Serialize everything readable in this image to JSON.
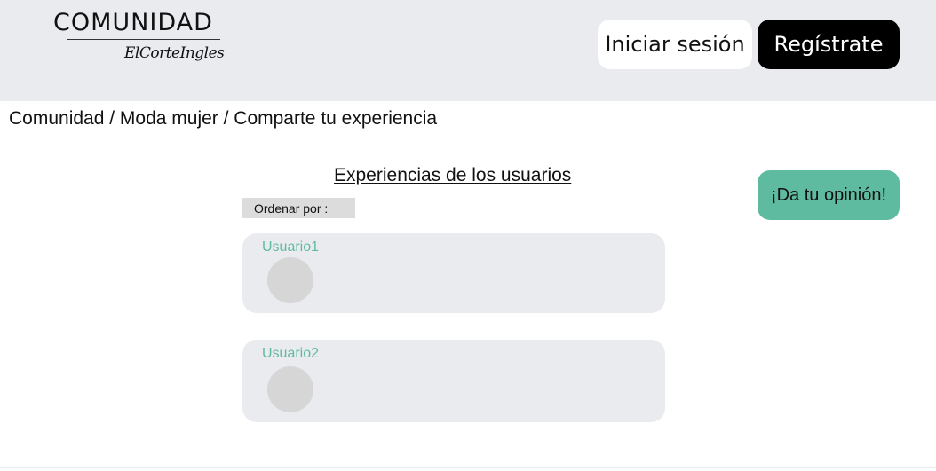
{
  "header": {
    "logo_title": "COMUNIDAD",
    "logo_subtitle": "ElCorteIngles",
    "login_label": "Iniciar sesión",
    "register_label": "Regístrate"
  },
  "breadcrumb": "Comunidad / Moda mujer / Comparte tu experiencia",
  "main": {
    "section_title": "Experiencias de los usuarios",
    "sort_label": "Ordenar por :",
    "opinion_button_label": "¡Da tu opinión!",
    "reviews": [
      {
        "user": "Usuario1"
      },
      {
        "user": "Usuario2"
      }
    ]
  },
  "colors": {
    "accent": "#5fbb9f",
    "header_bg": "#e9ebee",
    "card_bg": "#e9ebee",
    "register_bg": "#000000"
  },
  "icons": {
    "avatar": "user-avatar-placeholder"
  }
}
